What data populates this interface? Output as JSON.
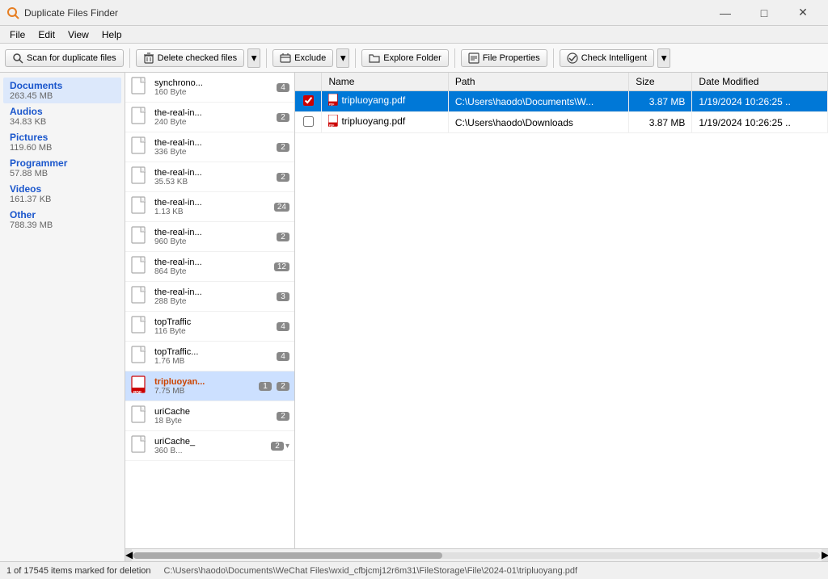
{
  "app": {
    "title": "Duplicate Files Finder",
    "icon": "🔍"
  },
  "titlebar": {
    "minimize": "—",
    "maximize": "□",
    "close": "✕"
  },
  "menubar": {
    "items": [
      "File",
      "Edit",
      "View",
      "Help"
    ]
  },
  "toolbar": {
    "scan_label": "Scan for duplicate files",
    "delete_label": "Delete checked files",
    "exclude_label": "Exclude",
    "explore_label": "Explore Folder",
    "properties_label": "File Properties",
    "check_label": "Check Intelligent"
  },
  "sidebar": {
    "items": [
      {
        "name": "Documents",
        "size": "263.45 MB",
        "active": true
      },
      {
        "name": "Audios",
        "size": "34.83 KB"
      },
      {
        "name": "Pictures",
        "size": "119.60 MB"
      },
      {
        "name": "Programmer",
        "size": "57.88 MB"
      },
      {
        "name": "Videos",
        "size": "161.37 KB"
      },
      {
        "name": "Other",
        "size": "788.39 MB"
      }
    ]
  },
  "file_list": {
    "items": [
      {
        "name": "synchrono...",
        "size": "160 Byte",
        "badge": "4",
        "badge2": "",
        "type": "generic"
      },
      {
        "name": "the-real-in...",
        "size": "240 Byte",
        "badge": "2",
        "badge2": "",
        "type": "generic"
      },
      {
        "name": "the-real-in...",
        "size": "336 Byte",
        "badge": "2",
        "badge2": "",
        "type": "generic"
      },
      {
        "name": "the-real-in...",
        "size": "35.53 KB",
        "badge": "2",
        "badge2": "",
        "type": "generic"
      },
      {
        "name": "the-real-in...",
        "size": "1.13 KB",
        "badge": "24",
        "badge2": "",
        "type": "generic"
      },
      {
        "name": "the-real-in...",
        "size": "960 Byte",
        "badge": "2",
        "badge2": "",
        "type": "generic"
      },
      {
        "name": "the-real-in...",
        "size": "864 Byte",
        "badge": "12",
        "badge2": "",
        "type": "generic"
      },
      {
        "name": "the-real-in...",
        "size": "288 Byte",
        "badge": "3",
        "badge2": "",
        "type": "generic"
      },
      {
        "name": "topTraffic",
        "size": "116 Byte",
        "badge": "4",
        "badge2": "",
        "type": "generic"
      },
      {
        "name": "topTraffic...",
        "size": "1.76 MB",
        "badge": "4",
        "badge2": "",
        "type": "generic"
      },
      {
        "name": "tripluoyan...",
        "size": "7.75 MB",
        "badge": "1",
        "badge2": "2",
        "type": "pdf",
        "selected": true
      },
      {
        "name": "uriCache",
        "size": "18 Byte",
        "badge": "2",
        "badge2": "",
        "type": "generic"
      },
      {
        "name": "uriCache_",
        "size": "360 B...",
        "badge": "2",
        "badge2": "",
        "type": "generic"
      }
    ]
  },
  "detail_table": {
    "columns": [
      "",
      "Name",
      "Path",
      "Size",
      "Date Modified"
    ],
    "rows": [
      {
        "checked": true,
        "name": "tripluoyang.pdf",
        "path": "C:\\Users\\haodo\\Documents\\W...",
        "path_full": "C:\\Users\\haodo\\Documents\\W...",
        "size": "3.87 MB",
        "date": "1/19/2024 10:26:25 ..",
        "selected": true
      },
      {
        "checked": false,
        "name": "tripluoyang.pdf",
        "path": "C:\\Users\\haodo\\Downloads",
        "path_full": "C:\\Users\\haodo\\Downloads",
        "size": "3.87 MB",
        "date": "1/19/2024 10:26:25 ..",
        "selected": false
      }
    ]
  },
  "statusbar": {
    "items_info": "1 of 17545 items marked for deletion",
    "path": "C:\\Users\\haodo\\Documents\\WeChat Files\\wxid_cfbjcmj12r6m31\\FileStorage\\File\\2024-01\\tripluoyang.pdf"
  }
}
